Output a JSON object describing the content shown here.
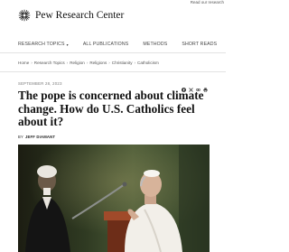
{
  "utility": {
    "link": "Read our research"
  },
  "brand": {
    "name": "Pew Research Center",
    "logo_icon": "pew-logo-icon"
  },
  "nav": {
    "items": [
      {
        "label": "RESEARCH TOPICS",
        "has_dropdown": true
      },
      {
        "label": "ALL PUBLICATIONS"
      },
      {
        "label": "METHODS"
      },
      {
        "label": "SHORT READS"
      }
    ]
  },
  "breadcrumb": [
    "Home",
    "Research Topics",
    "Religion",
    "Religions",
    "Christianity",
    "Catholicism"
  ],
  "article": {
    "date": "SEPTEMBER 28, 2023",
    "title": "The pope is concerned about climate change. How do U.S. Catholics feel about it?",
    "byline_prefix": "BY",
    "author": "JEFF DIAMANT",
    "share_icons": [
      "facebook-icon",
      "x-icon",
      "link-icon",
      "print-icon"
    ]
  },
  "photo": {
    "description_icon": "pope-speaking-photo"
  }
}
